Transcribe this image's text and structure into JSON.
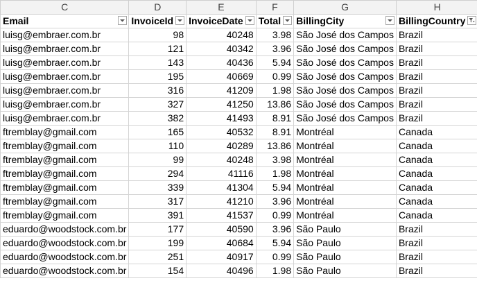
{
  "columns": [
    "C",
    "D",
    "E",
    "F",
    "G",
    "H"
  ],
  "headers": [
    "Email",
    "InvoiceId",
    "InvoiceDate",
    "Total",
    "BillingCity",
    "BillingCountry"
  ],
  "filter_icons": [
    "dropdown-arrow",
    "dropdown-arrow",
    "dropdown-arrow",
    "dropdown-arrow",
    "dropdown-arrow",
    "filter-funnel"
  ],
  "rows": [
    [
      "luisg@embraer.com.br",
      "98",
      "40248",
      "3.98",
      "São José dos Campos",
      "Brazil"
    ],
    [
      "luisg@embraer.com.br",
      "121",
      "40342",
      "3.96",
      "São José dos Campos",
      "Brazil"
    ],
    [
      "luisg@embraer.com.br",
      "143",
      "40436",
      "5.94",
      "São José dos Campos",
      "Brazil"
    ],
    [
      "luisg@embraer.com.br",
      "195",
      "40669",
      "0.99",
      "São José dos Campos",
      "Brazil"
    ],
    [
      "luisg@embraer.com.br",
      "316",
      "41209",
      "1.98",
      "São José dos Campos",
      "Brazil"
    ],
    [
      "luisg@embraer.com.br",
      "327",
      "41250",
      "13.86",
      "São José dos Campos",
      "Brazil"
    ],
    [
      "luisg@embraer.com.br",
      "382",
      "41493",
      "8.91",
      "São José dos Campos",
      "Brazil"
    ],
    [
      "ftremblay@gmail.com",
      "165",
      "40532",
      "8.91",
      "Montréal",
      "Canada"
    ],
    [
      "ftremblay@gmail.com",
      "110",
      "40289",
      "13.86",
      "Montréal",
      "Canada"
    ],
    [
      "ftremblay@gmail.com",
      "99",
      "40248",
      "3.98",
      "Montréal",
      "Canada"
    ],
    [
      "ftremblay@gmail.com",
      "294",
      "41116",
      "1.98",
      "Montréal",
      "Canada"
    ],
    [
      "ftremblay@gmail.com",
      "339",
      "41304",
      "5.94",
      "Montréal",
      "Canada"
    ],
    [
      "ftremblay@gmail.com",
      "317",
      "41210",
      "3.96",
      "Montréal",
      "Canada"
    ],
    [
      "ftremblay@gmail.com",
      "391",
      "41537",
      "0.99",
      "Montréal",
      "Canada"
    ],
    [
      "eduardo@woodstock.com.br",
      "177",
      "40590",
      "3.96",
      "São Paulo",
      "Brazil"
    ],
    [
      "eduardo@woodstock.com.br",
      "199",
      "40684",
      "5.94",
      "São Paulo",
      "Brazil"
    ],
    [
      "eduardo@woodstock.com.br",
      "251",
      "40917",
      "0.99",
      "São Paulo",
      "Brazil"
    ],
    [
      "eduardo@woodstock.com.br",
      "154",
      "40496",
      "1.98",
      "São Paulo",
      "Brazil"
    ]
  ]
}
